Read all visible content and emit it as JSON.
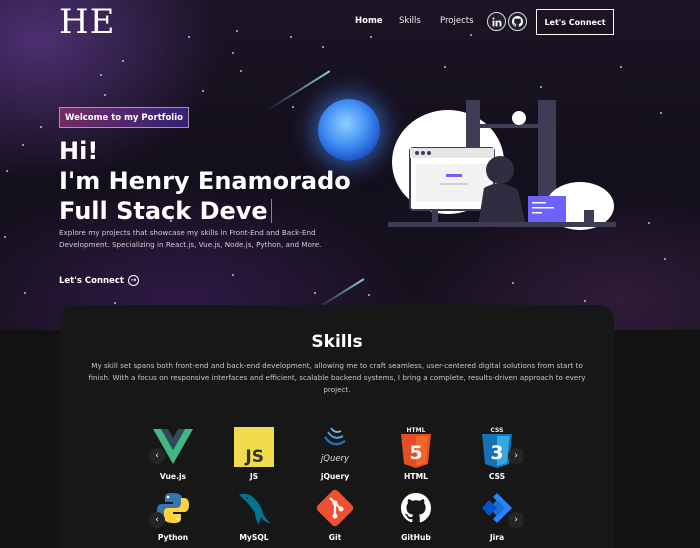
{
  "nav": {
    "logo": "HE",
    "links": [
      "Home",
      "Skills",
      "Projects"
    ],
    "social": [
      "linkedin-icon",
      "github-icon"
    ],
    "connect_label": "Let's Connect"
  },
  "hero": {
    "tagline": "Welcome to my Portfolio",
    "headline": [
      "Hi!",
      "I'm Henry Enamorado",
      "Full Stack Deve"
    ],
    "intro": "Explore my projects that showcase my skills in Front-End and Back-End Development. Specializing in React.js, Vue.js, Node.js, Python, and More.",
    "cta_label": "Let's Connect"
  },
  "skills": {
    "title": "Skills",
    "description": "My skill set spans both front-end and back-end development, allowing me to craft seamless, user-centered digital solutions from start to finish. With a focus on responsive interfaces and efficient, scalable backend systems, I bring a complete, results-driven approach to every project.",
    "row1": [
      "Vue.js",
      "JS",
      "jQuery",
      "HTML",
      "CSS"
    ],
    "row2": [
      "Python",
      "MySQL",
      "Git",
      "GitHub",
      "Jira"
    ],
    "icon_text": {
      "js": "JS",
      "jquery": "jQuery",
      "html": "HTML",
      "css": "CSS"
    }
  },
  "colors": {
    "vue_green": "#41b883",
    "vue_dark": "#34495e",
    "js_yellow": "#f0db4f",
    "html_orange": "#e44d26",
    "css_blue": "#1572b6",
    "git_red": "#f05032",
    "jira_blue": "#2684ff",
    "python_blue": "#3776ab",
    "python_yellow": "#ffd43b",
    "mysql_blue": "#00758f"
  }
}
